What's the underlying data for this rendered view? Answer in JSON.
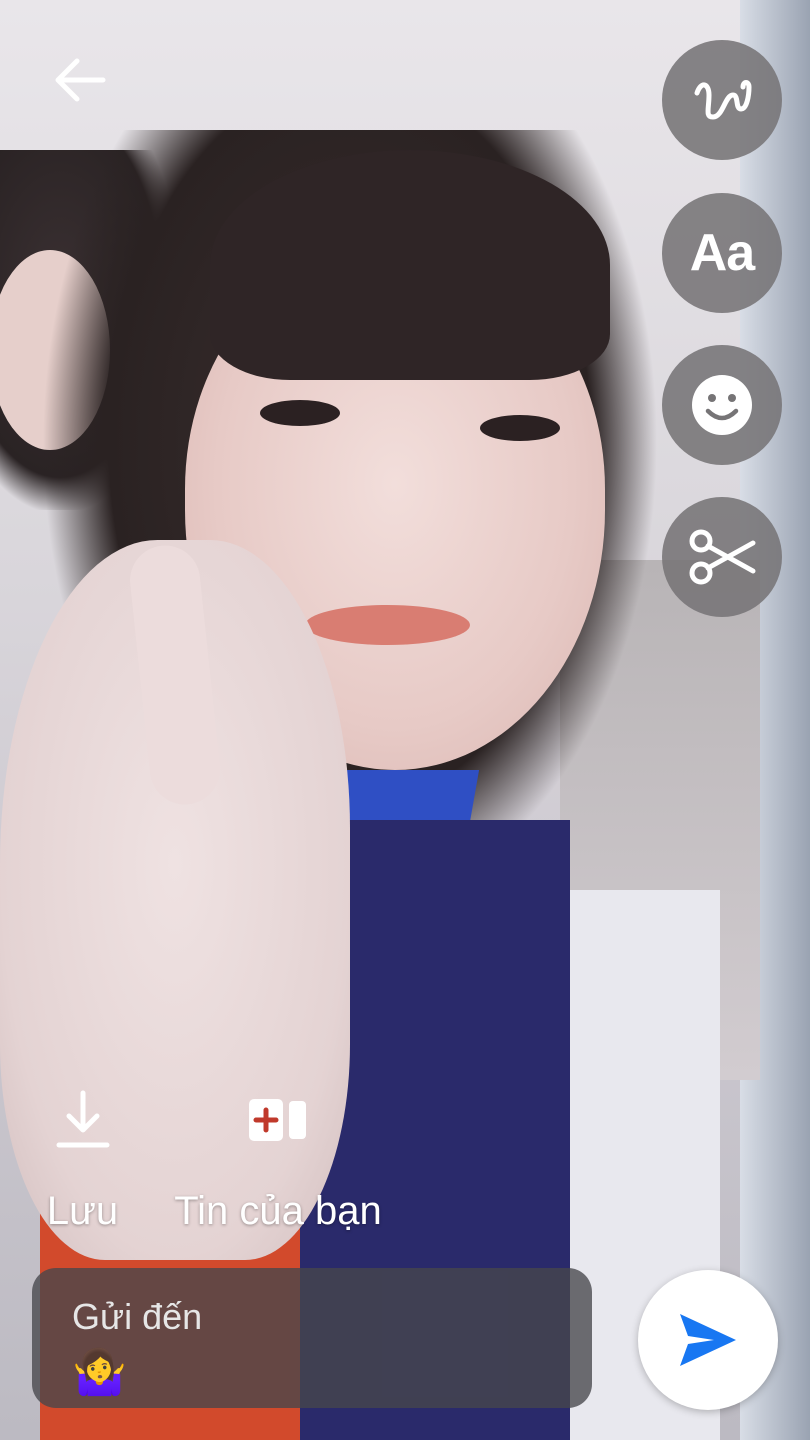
{
  "toolbar": {
    "back_icon": "arrow-left-icon",
    "tools": [
      {
        "name": "draw",
        "icon": "squiggle-icon"
      },
      {
        "name": "text",
        "label": "Aa"
      },
      {
        "name": "sticker",
        "icon": "smiley-icon"
      },
      {
        "name": "crop",
        "icon": "scissors-icon"
      }
    ]
  },
  "actions": {
    "save_label": "Lưu",
    "story_label": "Tin của bạn"
  },
  "send_to": {
    "label": "Gửi đến",
    "recipient_emoji": "🤷‍♀️"
  },
  "colors": {
    "accent": "#1877F2",
    "tool_bg": "#767476",
    "story_plus": "#c0392b"
  }
}
